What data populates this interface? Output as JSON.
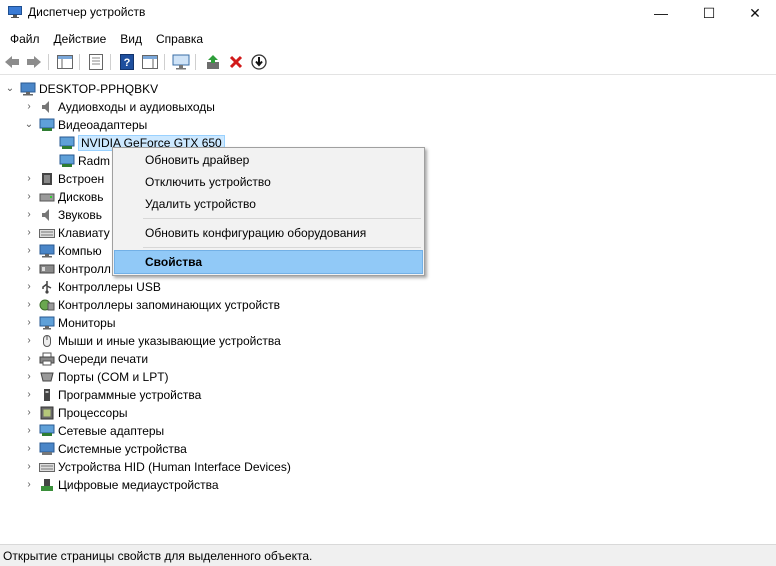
{
  "window": {
    "title": "Диспетчер устройств",
    "minimize": "—",
    "maximize": "☐",
    "close": "✕"
  },
  "menu": [
    "Файл",
    "Действие",
    "Вид",
    "Справка"
  ],
  "toolbar": {
    "icons": [
      "back-arrow-icon",
      "forward-arrow-icon",
      "properties-pane-icon",
      "show-hide-icon",
      "help-icon",
      "action-pane-icon",
      "monitor-scan-icon",
      "update-driver-icon",
      "uninstall-x-icon",
      "disable-device-icon"
    ],
    "colors": {
      "green": "#2e9e3a",
      "red": "#d11a1a",
      "blue": "#1e4f9e"
    }
  },
  "tree": {
    "root": "DESKTOP-PPHQBKV",
    "audio": "Аудиовходы и аудиовыходы",
    "video": "Видеоадаптеры",
    "gpu1": "NVIDIA GeForce GTX 650",
    "gpu2": "Radm",
    "builtin": "Встроен",
    "disks": "Дисковь",
    "sound": "Звуковь",
    "keyboards": "Клавиату",
    "computer": "Компью",
    "controllers_ide": "Контролл",
    "usb": "Контроллеры USB",
    "storage": "Контроллеры запоминающих устройств",
    "monitors": "Мониторы",
    "mice": "Мыши и иные указывающие устройства",
    "print_queue": "Очереди печати",
    "ports": "Порты (COM и LPT)",
    "software": "Программные устройства",
    "cpus": "Процессоры",
    "network": "Сетевые адаптеры",
    "system": "Системные устройства",
    "hid": "Устройства HID (Human Interface Devices)",
    "media": "Цифровые медиаустройства"
  },
  "context_menu": {
    "update_driver": "Обновить драйвер",
    "disable": "Отключить устройство",
    "uninstall": "Удалить устройство",
    "scan": "Обновить конфигурацию оборудования",
    "properties": "Свойства"
  },
  "status": "Открытие страницы свойств для выделенного объекта."
}
